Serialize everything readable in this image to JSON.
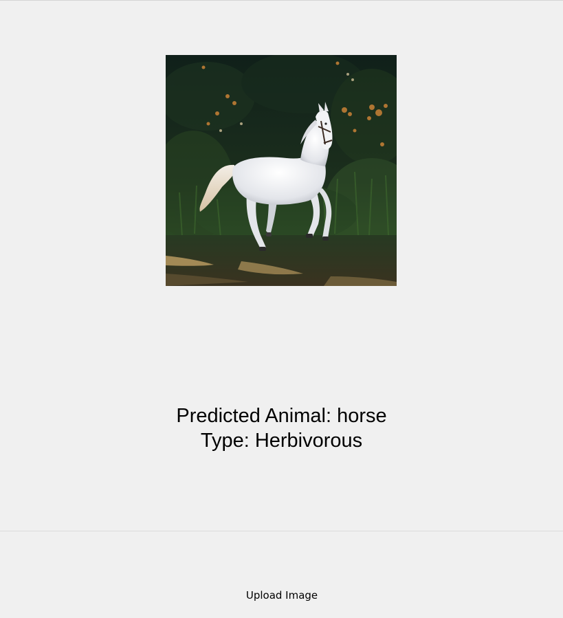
{
  "image": {
    "subject": "white-horse-galloping-in-forest",
    "colors": {
      "forest_dark": "#14241a",
      "foliage": "#2d4a24",
      "horse": "#ecedef",
      "ground": "#2c3a22",
      "sunlight": "#c9a768",
      "blossom": "#c98236"
    }
  },
  "prediction": {
    "animal_line": "Predicted Animal: horse",
    "type_line": "Type: Herbivorous"
  },
  "controls": {
    "upload_label": "Upload Image"
  }
}
